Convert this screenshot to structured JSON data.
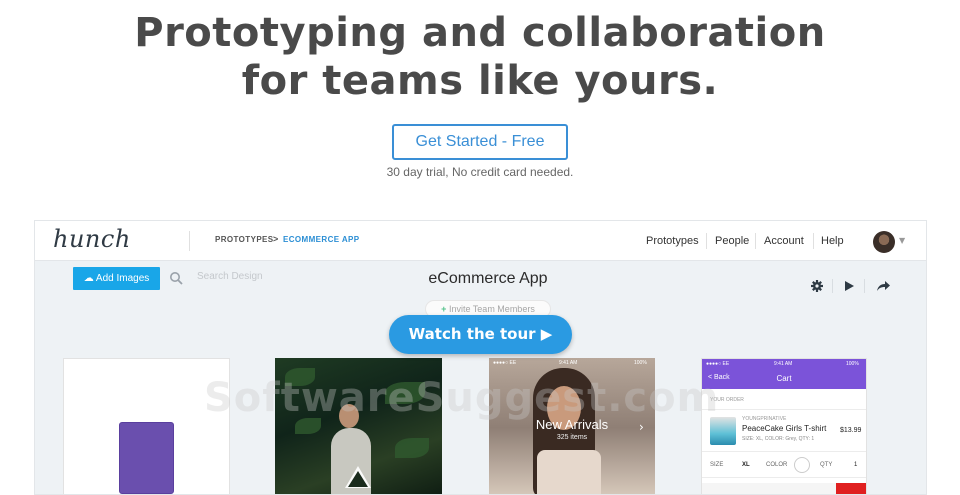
{
  "hero": {
    "line1": "Prototyping and collaboration",
    "line2": "for teams like yours.",
    "cta_label": "Get Started - Free",
    "trial_note": "30 day trial, No credit card needed."
  },
  "app": {
    "logo": "hunch",
    "breadcrumb": {
      "parent": "PROTOTYPES",
      "separator": ">",
      "current": "ECOMMERCE APP"
    },
    "nav": [
      "Prototypes",
      "People",
      "Account",
      "Help"
    ],
    "add_images_label": "Add Images",
    "search_placeholder": "Search Design",
    "title": "eCommerce App",
    "invite_label": "Invite Team Members",
    "invite_plus": "+",
    "tour_label": "Watch the tour ▶",
    "cards": {
      "arrivals_title": "New Arrivals",
      "arrivals_sub": "325 items",
      "status_carrier": "●●●●○ EE",
      "status_time": "9:41 AM",
      "status_battery": "100%",
      "cart_back": "< Back",
      "cart_title": "Cart",
      "cart_section": "YOUR ORDER",
      "cart_brand": "YOUNGPRINATIVE",
      "cart_item": "PeaceCake Girls T-shirt",
      "cart_meta": "SIZE: XL, COLOR: Grey, QTY: 1",
      "cart_price": "$13.99",
      "opt_size": "SIZE",
      "opt_size_val": "XL",
      "opt_color": "COLOR",
      "opt_qty": "QTY",
      "opt_qty_val": "1"
    },
    "watermark": "SoftwareSuggest.com"
  },
  "colors": {
    "accent": "#2a9ae2",
    "add_button": "#19a6e8",
    "cart_header": "#7b53d9",
    "swatch": "#6a4fae"
  }
}
